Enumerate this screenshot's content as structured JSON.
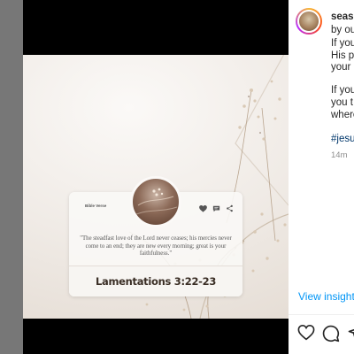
{
  "post": {
    "card": {
      "label": "Bible Verse",
      "quote": "\"The steadfast love of the Lord never ceases; his mercies never come to an end; they are new every morning; great is your faithfulness.\"",
      "reference": "Lamentations 3:22-23"
    }
  },
  "sidebar": {
    "username": "seaso",
    "caption_lines": [
      "by ou",
      "If you",
      "His p",
      "your"
    ],
    "caption_lines_2": [
      "If you",
      "you t",
      "where"
    ],
    "hashtag": "#jesu",
    "time": "14m",
    "view_insights": "View insights"
  },
  "icons": {
    "like": "heart-icon",
    "comment": "comment-icon",
    "share": "share-icon",
    "card_icons": [
      "heart-icon",
      "comment-icon",
      "share-icon"
    ]
  }
}
